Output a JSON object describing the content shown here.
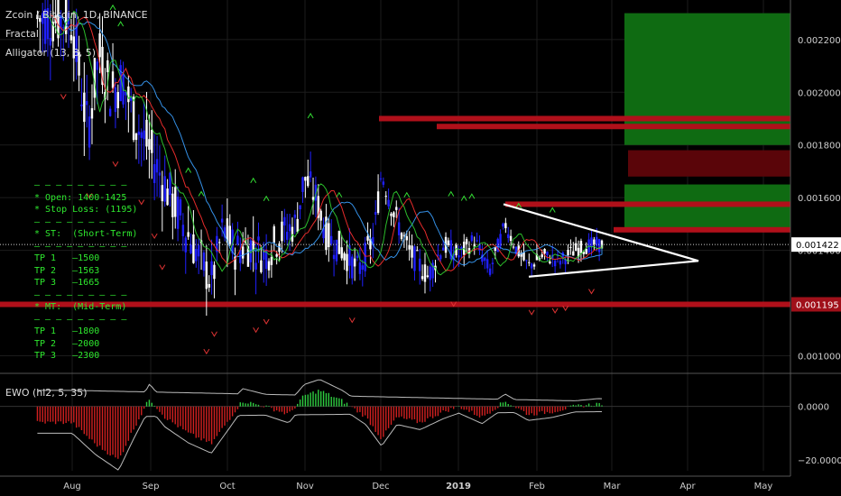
{
  "header": {
    "symbol_line": "Zcoin / Bitcoin, 1D, BINANCE",
    "indicator_1": "Fractal",
    "indicator_2": "Alligator (13, 8, 5)"
  },
  "notes": [
    {
      "text": "— — — — — — — — —"
    },
    {
      "text": "* Open: 1400-1425"
    },
    {
      "text": "* Stop Loss: (1195)"
    },
    {
      "text": "— — — — — — — — —"
    },
    {
      "text": "* ST:  (Short-Term)"
    },
    {
      "text": "— — — — — — — — —"
    },
    {
      "text": "TP 1   —1500"
    },
    {
      "text": "TP 2   —1563"
    },
    {
      "text": "TP 3   —1665"
    },
    {
      "text": "— — — — — — — — —"
    },
    {
      "text": "* MT:  (Mid-Term)"
    },
    {
      "text": "— — — — — — — — —"
    },
    {
      "text": "TP 1   —1800"
    },
    {
      "text": "TP 2   —2000"
    },
    {
      "text": "TP 3   —2300"
    }
  ],
  "colors": {
    "background": "#000000",
    "up_candle": "#ffffff",
    "down_candle": "#2020ff",
    "grid": "#1c1c1c",
    "resistance": "#b0101a",
    "target_zone": "#0f6b12",
    "stop_zone": "#5a0509",
    "note_text": "#2ee82e",
    "fractal": "#33dd33",
    "fractal_down": "#dd3333",
    "jaw": "#3aa0ff",
    "teeth": "#ff3030",
    "lips": "#30d030"
  },
  "chart_data": [
    {
      "type": "candlestick",
      "title": "Zcoin / Bitcoin, 1D, BINANCE",
      "x_ticks": [
        "Aug",
        "Sep",
        "Oct",
        "Nov",
        "Dec",
        "2019",
        "Feb",
        "Mar",
        "Apr",
        "May"
      ],
      "y_ticks": [
        "0.002200",
        "0.002000",
        "0.001800",
        "0.001600",
        "0.001400",
        "0.001000"
      ],
      "ylim": [
        0.00094,
        0.00235
      ],
      "current_price": "0.001422",
      "stop_price": "0.001195",
      "stop_value": 0.001195,
      "current_value": 0.001422,
      "resistance_levels": [
        0.0019,
        0.00187,
        0.001478,
        0.001575
      ],
      "target_zone": [
        0.0018,
        0.0023
      ],
      "stop_zone": [
        0.00168,
        0.00178
      ],
      "short_zone": [
        0.00148,
        0.00165
      ],
      "triangle": {
        "upper_start": 0.001575,
        "lower_start": 0.0013,
        "apex": 0.00136,
        "start_month": "Jan",
        "apex_month": "Apr"
      },
      "price_path": [
        [
          0.0,
          0.00228
        ],
        [
          0.1,
          0.00205
        ],
        [
          0.2,
          0.00185
        ],
        [
          0.35,
          0.00215
        ],
        [
          0.5,
          0.002
        ],
        [
          0.65,
          0.00205
        ],
        [
          0.8,
          0.0019
        ],
        [
          1.0,
          0.00178
        ],
        [
          1.2,
          0.00165
        ],
        [
          1.4,
          0.00152
        ],
        [
          1.6,
          0.0014
        ],
        [
          1.8,
          0.00128
        ],
        [
          1.95,
          0.00148
        ],
        [
          2.1,
          0.0014
        ],
        [
          2.3,
          0.00142
        ],
        [
          2.5,
          0.00138
        ],
        [
          2.7,
          0.00146
        ],
        [
          2.9,
          0.0015
        ],
        [
          3.0,
          0.00168
        ],
        [
          3.15,
          0.0016
        ],
        [
          3.3,
          0.00145
        ],
        [
          3.5,
          0.0014
        ],
        [
          3.7,
          0.00132
        ],
        [
          3.9,
          0.00145
        ],
        [
          4.0,
          0.0017
        ],
        [
          4.15,
          0.00155
        ],
        [
          4.35,
          0.0014
        ],
        [
          4.6,
          0.0013
        ],
        [
          4.8,
          0.00142
        ],
        [
          5.0,
          0.00138
        ],
        [
          5.2,
          0.00144
        ],
        [
          5.4,
          0.00132
        ],
        [
          5.6,
          0.0015
        ],
        [
          5.75,
          0.0014
        ],
        [
          5.9,
          0.00134
        ],
        [
          6.1,
          0.00138
        ],
        [
          6.3,
          0.00136
        ],
        [
          6.5,
          0.0014
        ],
        [
          6.7,
          0.00142
        ],
        [
          6.85,
          0.001422
        ]
      ]
    },
    {
      "type": "bar",
      "title": "EWO (hl2, 5, 35)",
      "y_ticks": [
        "0.0000",
        "−20.0000"
      ],
      "ylim": [
        -24,
        11
      ],
      "oscillator_path": [
        [
          0.0,
          -6
        ],
        [
          0.3,
          -14
        ],
        [
          0.6,
          -20
        ],
        [
          0.8,
          -8
        ],
        [
          1.0,
          3
        ],
        [
          1.2,
          -4
        ],
        [
          1.5,
          -10
        ],
        [
          1.8,
          -14
        ],
        [
          2.0,
          -6
        ],
        [
          2.2,
          2
        ],
        [
          2.5,
          0
        ],
        [
          2.8,
          -3
        ],
        [
          3.0,
          4
        ],
        [
          3.2,
          6
        ],
        [
          3.5,
          2
        ],
        [
          3.8,
          -4
        ],
        [
          4.0,
          -12
        ],
        [
          4.2,
          -4
        ],
        [
          4.5,
          -6
        ],
        [
          4.8,
          -2
        ],
        [
          5.0,
          0
        ],
        [
          5.3,
          -4
        ],
        [
          5.6,
          2
        ],
        [
          5.9,
          -3
        ],
        [
          6.2,
          -2
        ],
        [
          6.5,
          0
        ],
        [
          6.8,
          1
        ]
      ]
    }
  ]
}
